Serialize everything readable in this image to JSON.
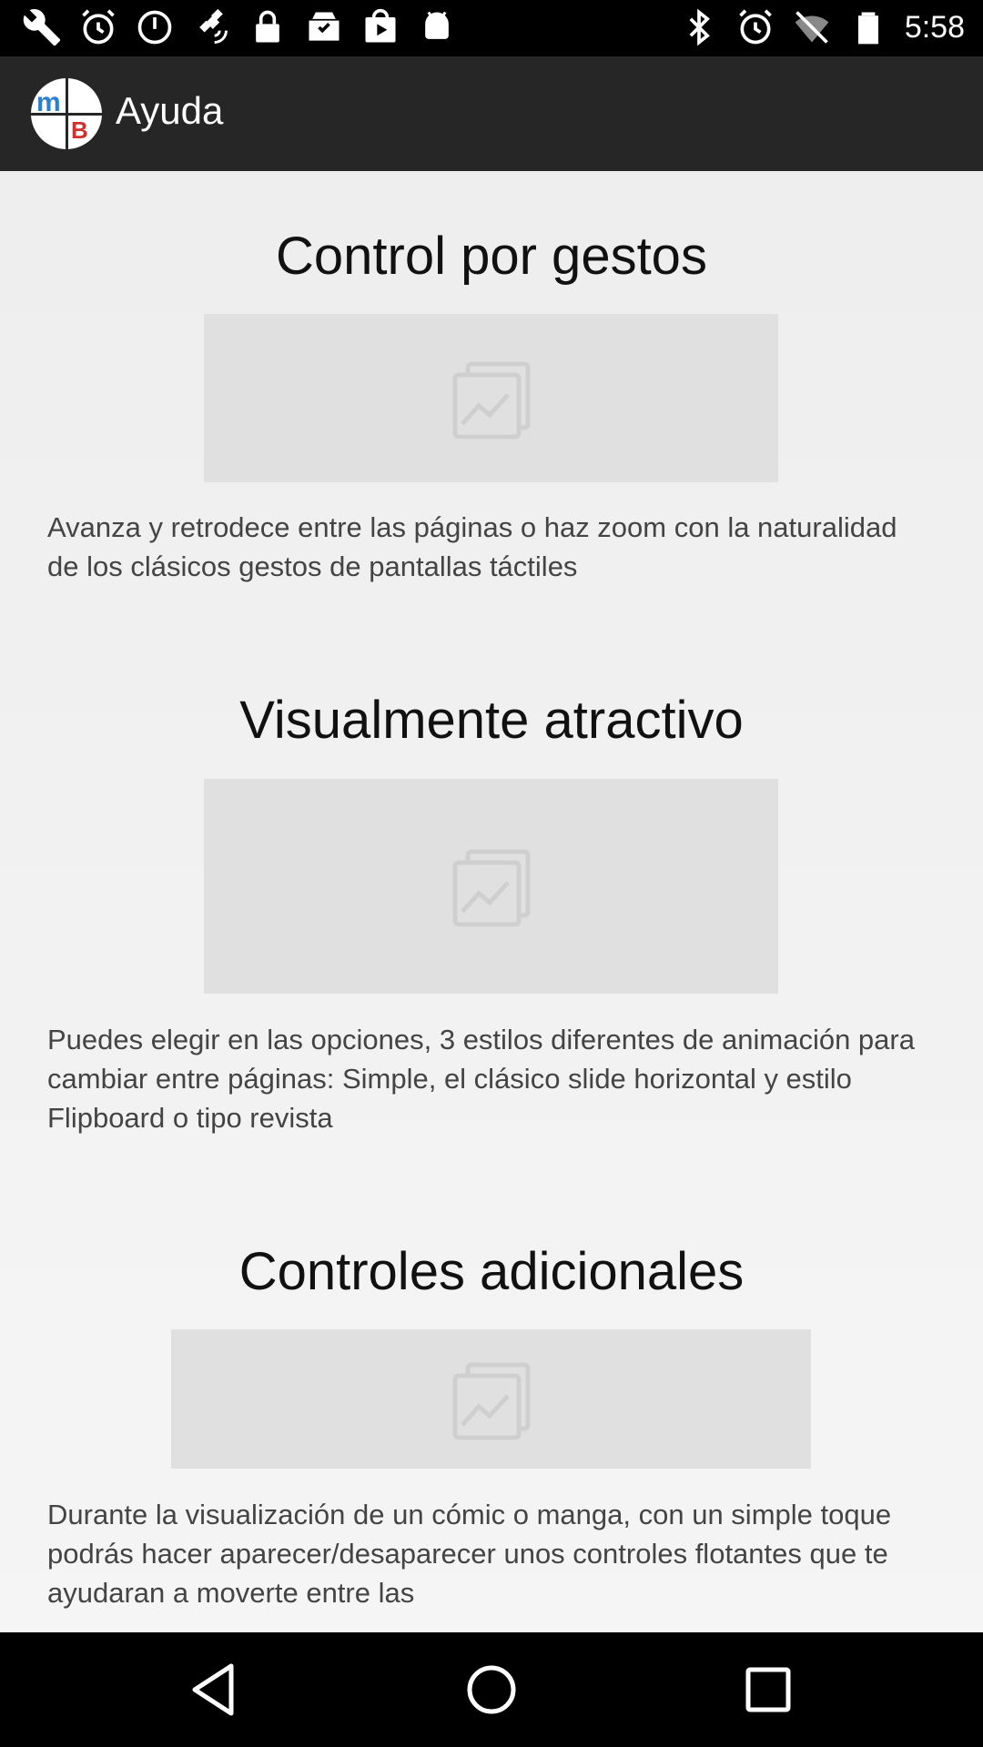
{
  "status_bar": {
    "time": "5:58",
    "left_icons": [
      "wrench-icon",
      "alarm-icon",
      "sync-icon",
      "satellite-icon",
      "lock-icon",
      "inbox-icon",
      "play-store-icon",
      "android-icon"
    ],
    "right_icons": [
      "bluetooth-icon",
      "alarm-icon",
      "wifi-off-icon",
      "battery-icon"
    ]
  },
  "app_bar": {
    "title": "Ayuda",
    "logo_text": "MB"
  },
  "sections": [
    {
      "title": "Control por gestos",
      "image_icon": "image-placeholder-icon",
      "description": "Avanza y retrodece entre las páginas o haz zoom con la naturalidad de los clásicos gestos de pantallas táctiles"
    },
    {
      "title": "Visualmente atractivo",
      "image_icon": "image-placeholder-icon",
      "description": "Puedes elegir en las opciones, 3 estilos diferentes de animación para cambiar entre páginas: Simple, el clásico slide horizontal y estilo Flipboard o tipo revista"
    },
    {
      "title": "Controles adicionales",
      "image_icon": "image-placeholder-icon",
      "description": "Durante la visualización de un cómic o manga, con un simple toque podrás hacer aparecer/desaparecer unos controles flotantes que te ayudaran a moverte entre las"
    }
  ],
  "nav_bar": {
    "buttons": [
      "back-icon",
      "home-icon",
      "recents-icon"
    ]
  },
  "colors": {
    "app_bar": "#262626",
    "background": "#f2f2f2",
    "placeholder": "#e0e0e0",
    "logo_blue": "#2a7fd4",
    "logo_red": "#d32f2f"
  }
}
